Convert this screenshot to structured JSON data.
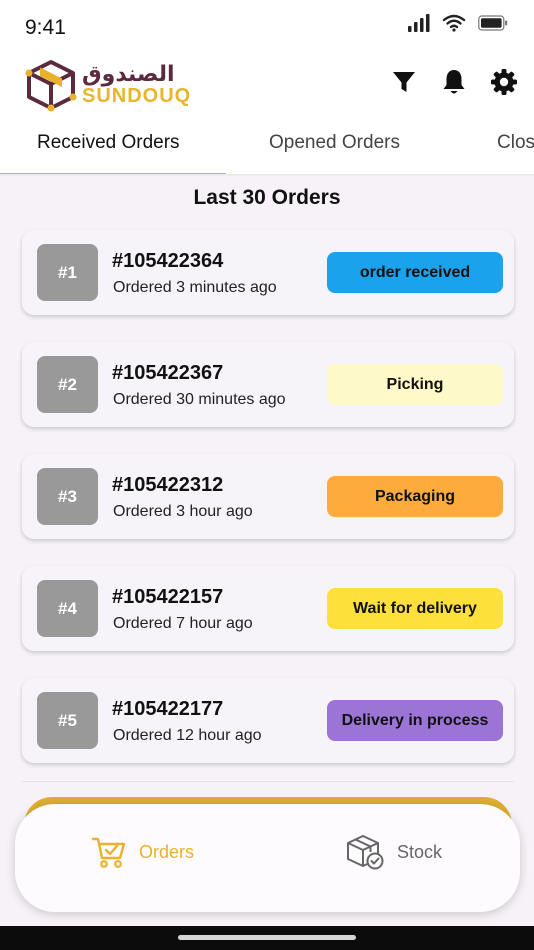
{
  "status_bar": {
    "time": "9:41"
  },
  "brand": {
    "arabic": "الصندوق",
    "latin": "SUNDOUQ",
    "accent": "#e9b22a",
    "dark": "#5b2a3e"
  },
  "header": {
    "icons": [
      "filter-icon",
      "bell-icon",
      "gear-icon"
    ]
  },
  "tabs": [
    {
      "label": "Received Orders",
      "active": true
    },
    {
      "label": "Opened Orders",
      "active": false
    },
    {
      "label": "Closed Orders",
      "active": false
    }
  ],
  "list_title": "Last 30 Orders",
  "orders": [
    {
      "rank": "#1",
      "id": "#105422364",
      "ago": "Ordered 3 minutes ago",
      "status": "order received",
      "color": "#1aa3ec"
    },
    {
      "rank": "#2",
      "id": "#105422367",
      "ago": "Ordered 30 minutes ago",
      "status": "Picking",
      "color": "#fef9c8"
    },
    {
      "rank": "#3",
      "id": "#105422312",
      "ago": "Ordered 3 hour ago",
      "status": "Packaging",
      "color": "#fdab3c"
    },
    {
      "rank": "#4",
      "id": "#105422157",
      "ago": "Ordered 7 hour ago",
      "status": "Wait for delivery",
      "color": "#fde03a"
    },
    {
      "rank": "#5",
      "id": "#105422177",
      "ago": "Ordered 12 hour ago",
      "status": "Delivery in process",
      "color": "#9b74d6"
    }
  ],
  "bottom_nav": [
    {
      "label": "Orders",
      "icon": "cart-check-icon",
      "active": true
    },
    {
      "label": "Stock",
      "icon": "box-check-icon",
      "active": false
    }
  ]
}
